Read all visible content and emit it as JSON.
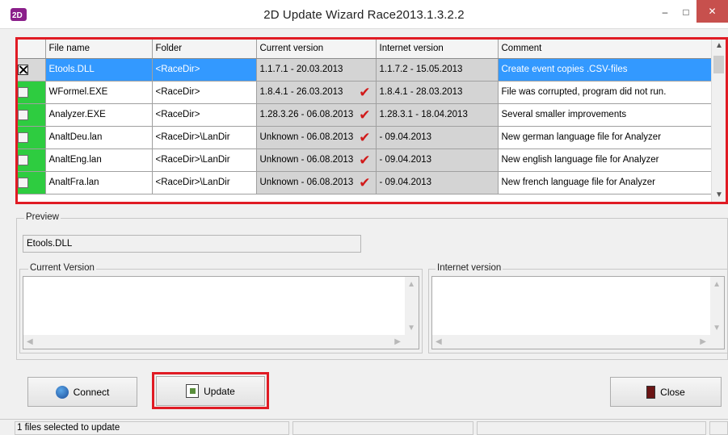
{
  "window": {
    "title": "2D Update Wizard   Race2013.1.3.2.2",
    "icon": "2d-app-icon",
    "controls": {
      "minimize": "–",
      "maximize": "□",
      "close": "✕"
    }
  },
  "grid": {
    "columns": [
      "",
      "File name",
      "Folder",
      "Current version",
      "Internet version",
      "Comment"
    ],
    "rows": [
      {
        "checked": true,
        "selected": true,
        "file": "Etools.DLL",
        "folder": "<RaceDir>",
        "current": "1.1.7.1 - 20.03.2013",
        "tick": false,
        "internet": "1.1.7.2 - 15.05.2013",
        "comment": "Create event copies .CSV-files"
      },
      {
        "checked": false,
        "selected": false,
        "file": "WFormel.EXE",
        "folder": "<RaceDir>",
        "current": "1.8.4.1 - 26.03.2013",
        "tick": true,
        "internet": "1.8.4.1 - 28.03.2013",
        "comment": "File was corrupted, program did not run."
      },
      {
        "checked": false,
        "selected": false,
        "file": "Analyzer.EXE",
        "folder": "<RaceDir>",
        "current": "1.28.3.26 - 06.08.2013",
        "tick": true,
        "internet": "1.28.3.1 - 18.04.2013",
        "comment": "Several smaller improvements"
      },
      {
        "checked": false,
        "selected": false,
        "file": "AnaltDeu.lan",
        "folder": "<RaceDir>\\LanDir",
        "current": "Unknown - 06.08.2013",
        "tick": true,
        "internet": " - 09.04.2013",
        "comment": "New german language file for Analyzer"
      },
      {
        "checked": false,
        "selected": false,
        "file": "AnaltEng.lan",
        "folder": "<RaceDir>\\LanDir",
        "current": "Unknown - 06.08.2013",
        "tick": true,
        "internet": " - 09.04.2013",
        "comment": "New english language file for Analyzer"
      },
      {
        "checked": false,
        "selected": false,
        "file": "AnaltFra.lan",
        "folder": "<RaceDir>\\LanDir",
        "current": "Unknown - 06.08.2013",
        "tick": true,
        "internet": " - 09.04.2013",
        "comment": "New french language file for Analyzer"
      }
    ]
  },
  "preview": {
    "label": "Preview",
    "file_value": "Etools.DLL",
    "current_version_label": "Current Version",
    "internet_version_label": "Internet version"
  },
  "buttons": {
    "connect": "Connect",
    "update": "Update",
    "close": "Close"
  },
  "status": {
    "text": "1 files selected to update"
  },
  "colors": {
    "highlight_border": "#e01b24",
    "check_column": "#2ecc40",
    "selection": "#3399ff",
    "version_bg": "#d4d4d4",
    "tick": "#d11a1a"
  }
}
